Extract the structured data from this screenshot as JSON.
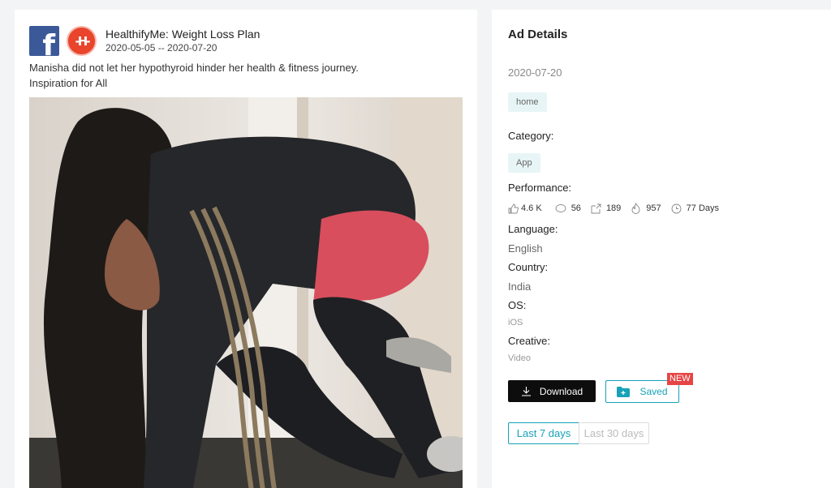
{
  "ad": {
    "brand_name": "HealthifyMe: Weight Loss Plan",
    "date_range": "2020-05-05 -- 2020-07-20",
    "caption": "Manisha did not let her hypothyroid hinder her health & fitness journey. Inspiration for All",
    "fb_glyph": "f",
    "brand_logo_glyph": "-H-"
  },
  "details": {
    "title": "Ad Details",
    "date": "2020-07-20",
    "tag": "home",
    "category_label": "Category:",
    "category_value": "App",
    "performance_label": "Performance:",
    "performance": {
      "likes": "4.6 K",
      "comments": "56",
      "shares": "189",
      "heat": "957",
      "duration": "77 Days"
    },
    "language_label": "Language:",
    "language_value": "English",
    "country_label": "Country:",
    "country_value": "India",
    "os_label": "OS:",
    "os_value": "iOS",
    "creative_label": "Creative:",
    "creative_value": "Video",
    "download_label": "Download",
    "saved_label": "Saved",
    "new_badge": "NEW",
    "range_options": [
      "Last 7 days",
      "Last 30 days"
    ]
  },
  "icons": [
    "facebook-logo",
    "brand-logo",
    "like-icon",
    "comment-icon",
    "share-icon",
    "fire-icon",
    "clock-icon",
    "download-icon",
    "folder-plus-icon"
  ],
  "colors": {
    "accent": "#17a2b8",
    "facebook": "#3b5998",
    "new_badge": "#e64545",
    "tag_bg": "#e8f5f6"
  }
}
